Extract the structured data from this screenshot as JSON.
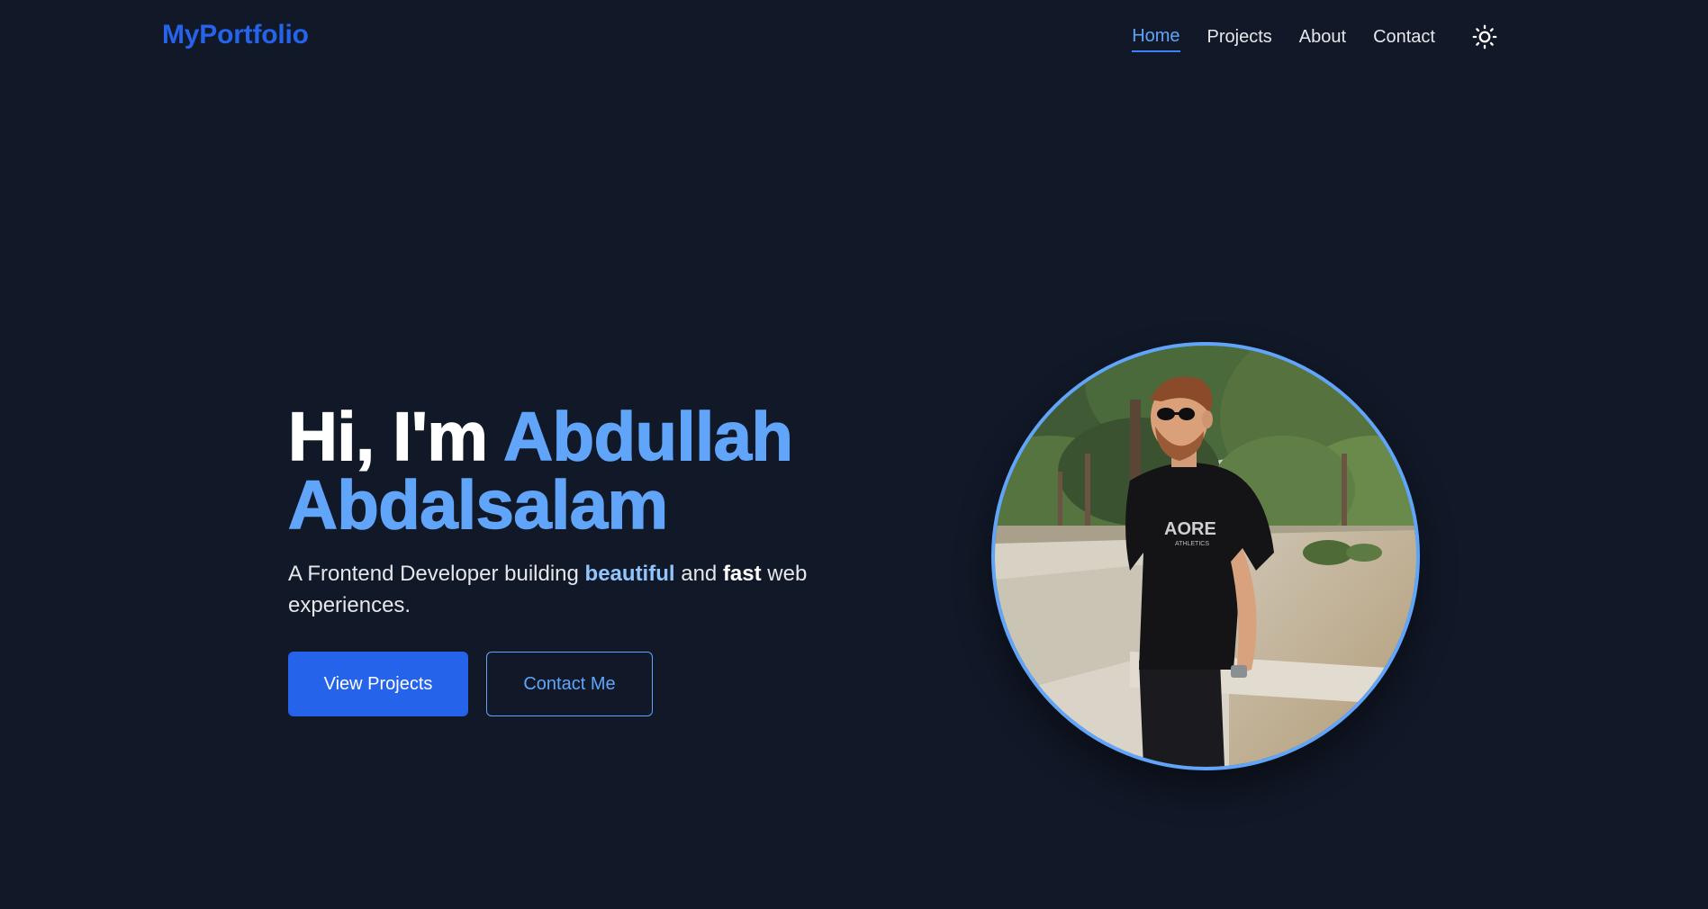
{
  "navbar": {
    "logo": "MyPortfolio",
    "links": [
      {
        "label": "Home",
        "active": true
      },
      {
        "label": "Projects",
        "active": false
      },
      {
        "label": "About",
        "active": false
      },
      {
        "label": "Contact",
        "active": false
      }
    ],
    "theme_toggle_icon": "sun-icon"
  },
  "hero": {
    "greeting": "Hi, I'm",
    "name": "Abdullah Abdalsalam",
    "subtitle": {
      "part1": "A Frontend Developer building",
      "highlight1": "beautiful",
      "part2": "and",
      "highlight2": "fast",
      "part3": "web experiences."
    },
    "buttons": {
      "primary": "View Projects",
      "secondary": "Contact Me"
    },
    "photo_icon": "profile-photo"
  },
  "colors": {
    "background": "#111827",
    "accent": "#2563eb",
    "accent_light": "#60a5fa",
    "highlight": "#93c5fd",
    "text": "#e5e7eb"
  }
}
